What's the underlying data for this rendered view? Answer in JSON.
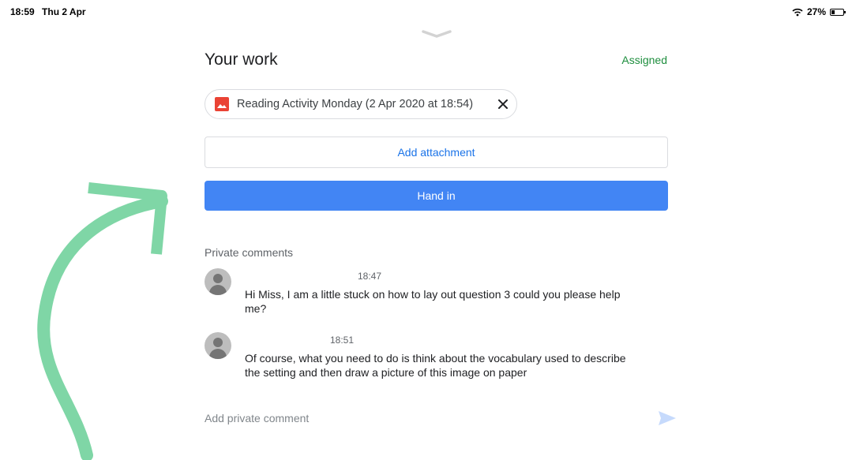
{
  "status_bar": {
    "time": "18:59",
    "date": "Thu 2 Apr",
    "battery": "27%"
  },
  "page": {
    "title": "Your work",
    "status": "Assigned"
  },
  "attachment": {
    "name": "Reading Activity Monday (2 Apr 2020 at 18:54)"
  },
  "actions": {
    "add_attachment": "Add attachment",
    "hand_in": "Hand in"
  },
  "comments": {
    "header": "Private comments",
    "items": [
      {
        "time": "18:47",
        "text": "Hi Miss, I am a little stuck on how to lay out question 3 could you please help me?"
      },
      {
        "time": "18:51",
        "text": "Of course, what you need to do is think about the vocabulary used to describe the setting and then draw a picture of this image on paper"
      }
    ],
    "placeholder": "Add private comment"
  },
  "colors": {
    "accent": "#1a73e8",
    "primary_button": "#4285f4",
    "assigned": "#1e8e3e",
    "annotation": "#7fd6a6"
  }
}
